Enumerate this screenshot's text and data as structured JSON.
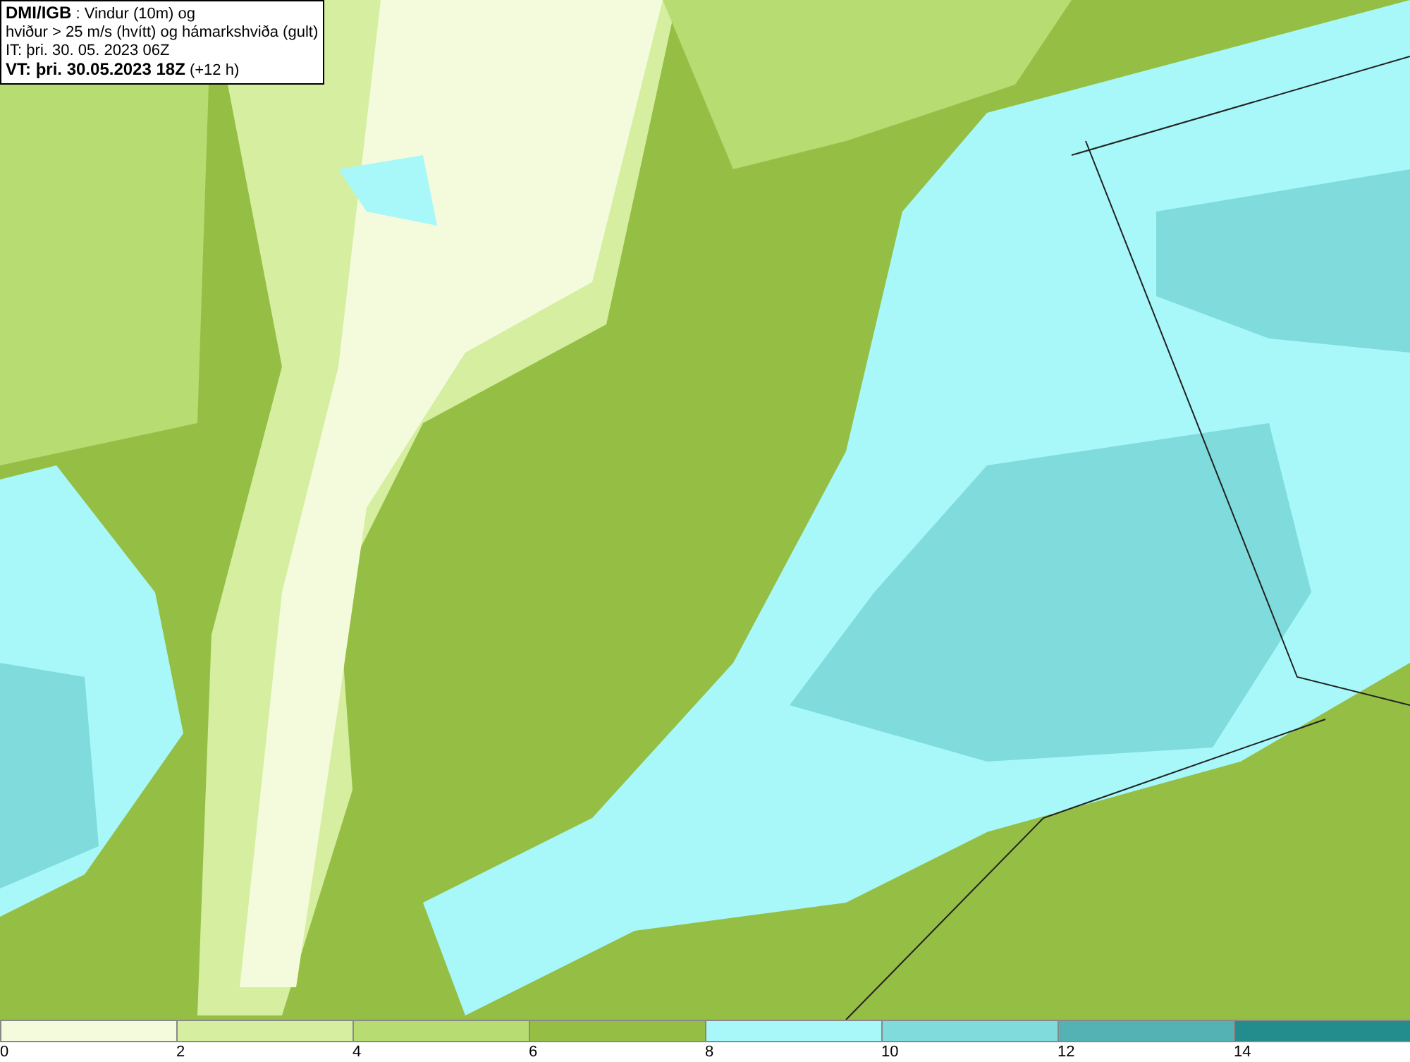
{
  "info_box": {
    "lines": [
      "**DMI/IGB** : Vindur (10m) og",
      "hviður > 25 m/s (hvítt) og hámarkshviða (gult)",
      "IT: þri. 30. 05. 2023 06Z",
      "**VT: þri. 30.05.2023 18Z** (+12 h)"
    ]
  },
  "legend": {
    "bins": [
      {
        "color": "#f4fbdc"
      },
      {
        "color": "#d5eea0"
      },
      {
        "color": "#b6dc72"
      },
      {
        "color": "#95bf44"
      },
      {
        "color": "#a8f8fa"
      },
      {
        "color": "#7fdbdc"
      },
      {
        "color": "#54b2b4"
      },
      {
        "color": "#238c8c"
      }
    ],
    "ticks": [
      "0",
      "2",
      "4",
      "6",
      "8",
      "10",
      "12",
      "14"
    ]
  }
}
